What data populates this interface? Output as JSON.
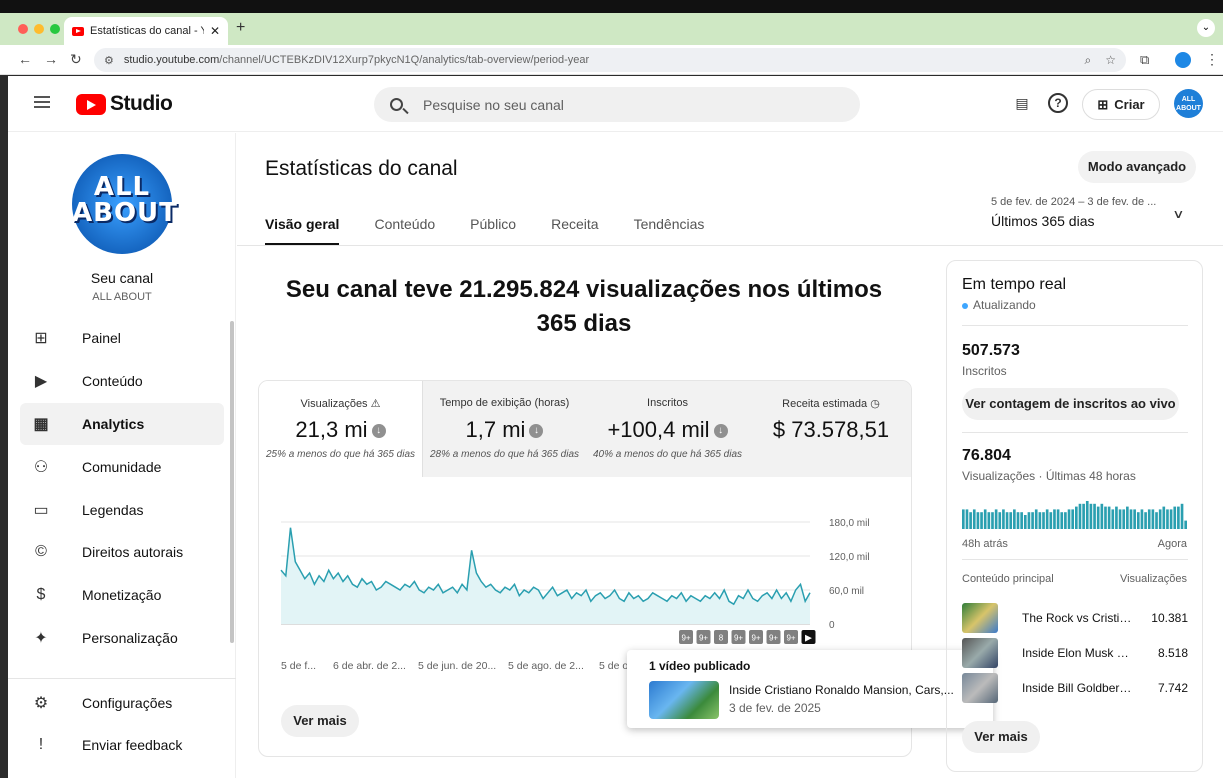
{
  "browser": {
    "tab_title": "Estatísticas do canal - YouTube",
    "new_tab": "+",
    "url_host": "studio.youtube.com",
    "url_path": "/channel/UCTEBKzDIV12Xurp7pkycN1Q/analytics/tab-overview/period-year"
  },
  "header": {
    "logo_text": "Studio",
    "search_placeholder": "Pesquise no seu canal",
    "create_label": "Criar",
    "avatar_text": "ALL ABOUT"
  },
  "sidebar": {
    "channel_avatar_text": "ALL ABOUT",
    "channel_label": "Seu canal",
    "channel_name": "ALL ABOUT",
    "items": [
      {
        "label": "Painel",
        "icon": "dashboard-icon"
      },
      {
        "label": "Conteúdo",
        "icon": "content-icon"
      },
      {
        "label": "Analytics",
        "icon": "analytics-icon",
        "active": true
      },
      {
        "label": "Comunidade",
        "icon": "community-icon"
      },
      {
        "label": "Legendas",
        "icon": "subtitles-icon"
      },
      {
        "label": "Direitos autorais",
        "icon": "copyright-icon"
      },
      {
        "label": "Monetização",
        "icon": "dollar-icon"
      },
      {
        "label": "Personalização",
        "icon": "magic-wand-icon"
      },
      {
        "label": "Configurações",
        "icon": "gear-icon"
      },
      {
        "label": "Enviar feedback",
        "icon": "feedback-icon"
      }
    ]
  },
  "main": {
    "title": "Estatísticas do canal",
    "advanced_mode": "Modo avançado",
    "tabs": [
      "Visão geral",
      "Conteúdo",
      "Público",
      "Receita",
      "Tendências"
    ],
    "period_dates": "5 de fev. de 2024 – 3 de fev. de ...",
    "period_label": "Últimos 365 dias",
    "headline": "Seu canal teve 21.295.824 visualizações nos últimos 365 dias",
    "see_more": "Ver mais"
  },
  "metrics": [
    {
      "label": "Visualizações",
      "value": "21,3 mi",
      "comparison": "25% a menos do que há 365 dias",
      "warning": true,
      "down": true
    },
    {
      "label": "Tempo de exibição (horas)",
      "value": "1,7 mi",
      "comparison": "28% a menos do que há 365 dias",
      "down": true
    },
    {
      "label": "Inscritos",
      "value": "+100,4 mil",
      "comparison": "40% a menos do que há 365 dias",
      "down": true
    },
    {
      "label": "Receita estimada",
      "value": "$ 73.578,51",
      "comparison": ""
    }
  ],
  "chart_data": {
    "type": "area",
    "series": [
      {
        "values": [
          95,
          85,
          170,
          110,
          95,
          80,
          90,
          70,
          85,
          75,
          95,
          80,
          90,
          75,
          85,
          70,
          65,
          80,
          70,
          75,
          60,
          65,
          75,
          70,
          65,
          60,
          70,
          65,
          75,
          60,
          55,
          65,
          60,
          70,
          55,
          60,
          65,
          55,
          70,
          60,
          130,
          90,
          75,
          65,
          70,
          60,
          55,
          65,
          60,
          70,
          50,
          60,
          55,
          65,
          60,
          45,
          55,
          65,
          50,
          55,
          60,
          45,
          55,
          50,
          60,
          40,
          50,
          55,
          45,
          50,
          60,
          45,
          40,
          55,
          45,
          50,
          40,
          45,
          55,
          50,
          45,
          40,
          50,
          45,
          55,
          40,
          50,
          45,
          40,
          50,
          45,
          55,
          45,
          60,
          40,
          35,
          50,
          45,
          60,
          45,
          40,
          50,
          55,
          45,
          60,
          45,
          55,
          40,
          60,
          70,
          40,
          55
        ]
      }
    ],
    "y_ticks": [
      "180,0 mil",
      "120,0 mil",
      "60,0 mil",
      "0"
    ],
    "ylim": [
      0,
      180
    ],
    "x_ticks": [
      "5 de f...",
      "6 de abr. de 2...",
      "5 de jun. de 20...",
      "5 de ago. de 2...",
      "5 de o..."
    ],
    "video_markers": [
      "9+",
      "9+",
      "8",
      "9+",
      "9+",
      "9+",
      "9+",
      "▶"
    ],
    "color": "#2a9fb0"
  },
  "tooltip": {
    "header": "1 vídeo publicado",
    "video_title": "Inside Cristiano Ronaldo Mansion, Cars,...",
    "video_date": "3 de fev. de 2025"
  },
  "realtime": {
    "title": "Em tempo real",
    "status": "Atualizando",
    "subscribers": "507.573",
    "subscribers_label": "Inscritos",
    "live_button": "Ver contagem de inscritos ao vivo",
    "views": "76.804",
    "views_label": "Visualizações · Últimas 48 horas",
    "bars": [
      7,
      7,
      6,
      7,
      6,
      6,
      7,
      6,
      6,
      7,
      6,
      7,
      6,
      6,
      7,
      6,
      6,
      5,
      6,
      6,
      7,
      6,
      6,
      7,
      6,
      7,
      7,
      6,
      6,
      7,
      7,
      8,
      9,
      9,
      10,
      9,
      9,
      8,
      9,
      8,
      8,
      7,
      8,
      7,
      7,
      8,
      7,
      7,
      6,
      7,
      6,
      7,
      7,
      6,
      7,
      8,
      7,
      7,
      8,
      8,
      9,
      3
    ],
    "ago_label": "48h atrás",
    "now_label": "Agora",
    "top_content_label": "Conteúdo principal",
    "top_views_label": "Visualizações",
    "top_content": [
      {
        "title": "The Rock vs Cristia...",
        "views": "10.381"
      },
      {
        "title": "Inside Elon Musk Lif...",
        "views": "8.518"
      },
      {
        "title": "Inside Bill Goldberg ...",
        "views": "7.742"
      }
    ],
    "see_more": "Ver mais"
  }
}
